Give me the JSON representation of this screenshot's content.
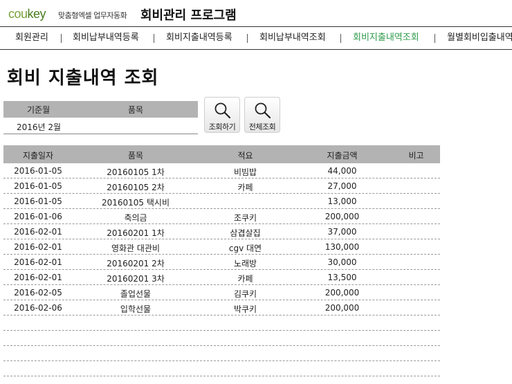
{
  "header": {
    "logo_part1": "cou",
    "logo_part2": "key",
    "tagline": "맞춤형엑셀 업무자동화",
    "app_title": "회비관리 프로그램"
  },
  "menu": {
    "items": [
      {
        "label": "회원관리",
        "active": false
      },
      {
        "label": "회비납부내역등록",
        "active": false
      },
      {
        "label": "회비지출내역등록",
        "active": false
      },
      {
        "label": "회비납부내역조회",
        "active": false
      },
      {
        "label": "회비지출내역조회",
        "active": true
      },
      {
        "label": "월별회비입출내역",
        "active": false
      }
    ]
  },
  "page": {
    "title": "회비 지출내역 조회"
  },
  "filter": {
    "month_label": "기준월",
    "item_label": "품목",
    "month_value": "2016년 2월",
    "item_value": ""
  },
  "buttons": {
    "search": "조회하기",
    "search_all": "전체조회"
  },
  "table": {
    "headers": [
      "지출일자",
      "품목",
      "적요",
      "지출금액",
      "비고"
    ],
    "rows": [
      [
        "2016-01-05",
        "20160105 1차",
        "비빔밥",
        "44,000",
        ""
      ],
      [
        "2016-01-05",
        "20160105 2차",
        "카페",
        "27,000",
        ""
      ],
      [
        "2016-01-05",
        "20160105 택시비",
        "",
        "13,000",
        ""
      ],
      [
        "2016-01-06",
        "축의금",
        "조쿠키",
        "200,000",
        ""
      ],
      [
        "2016-02-01",
        "20160201 1차",
        "삼겹살집",
        "37,000",
        ""
      ],
      [
        "2016-02-01",
        "영화관 대관비",
        "cgv 대연",
        "130,000",
        ""
      ],
      [
        "2016-02-01",
        "20160201 2차",
        "노래방",
        "30,000",
        ""
      ],
      [
        "2016-02-01",
        "20160201 3차",
        "카페",
        "13,500",
        ""
      ],
      [
        "2016-02-05",
        "졸업선물",
        "김쿠키",
        "200,000",
        ""
      ],
      [
        "2016-02-06",
        "입학선물",
        "박쿠키",
        "200,000",
        ""
      ],
      [
        "",
        "",
        "",
        "",
        ""
      ],
      [
        "",
        "",
        "",
        "",
        ""
      ],
      [
        "",
        "",
        "",
        "",
        ""
      ],
      [
        "",
        "",
        "",
        "",
        ""
      ]
    ]
  },
  "colors": {
    "active_menu": "#2e9a4a",
    "header_fill": "#b3b3b3",
    "logo_green": "#4a7c1e"
  }
}
